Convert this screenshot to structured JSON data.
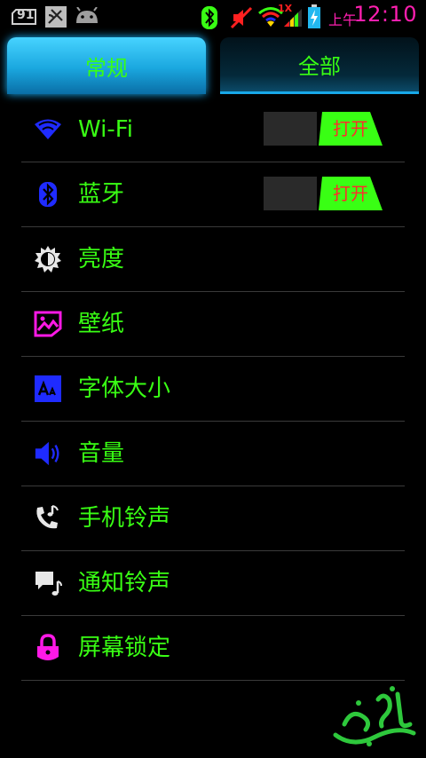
{
  "statusbar": {
    "sim_badge": "91",
    "network_type": "1X",
    "ampm": "上午",
    "time": "12:10"
  },
  "tabs": [
    {
      "label": "常规",
      "active": true
    },
    {
      "label": "全部",
      "active": false
    }
  ],
  "settings": [
    {
      "icon": "wifi-icon",
      "label": "Wi-Fi",
      "toggle": "打开"
    },
    {
      "icon": "bluetooth-icon",
      "label": "蓝牙",
      "toggle": "打开"
    },
    {
      "icon": "brightness-icon",
      "label": "亮度"
    },
    {
      "icon": "wallpaper-icon",
      "label": "壁纸"
    },
    {
      "icon": "font-size-icon",
      "label": "字体大小"
    },
    {
      "icon": "volume-icon",
      "label": "音量"
    },
    {
      "icon": "phone-ringtone-icon",
      "label": "手机铃声"
    },
    {
      "icon": "notification-ringtone-icon",
      "label": "通知铃声"
    },
    {
      "icon": "lock-icon",
      "label": "屏幕锁定"
    }
  ],
  "colors": {
    "text": "#39ff14",
    "toggle_on": "#39ff14",
    "toggle_text": "#ff2b2b",
    "tab_active": "#1aa7df",
    "time": "#ff1fb0"
  }
}
